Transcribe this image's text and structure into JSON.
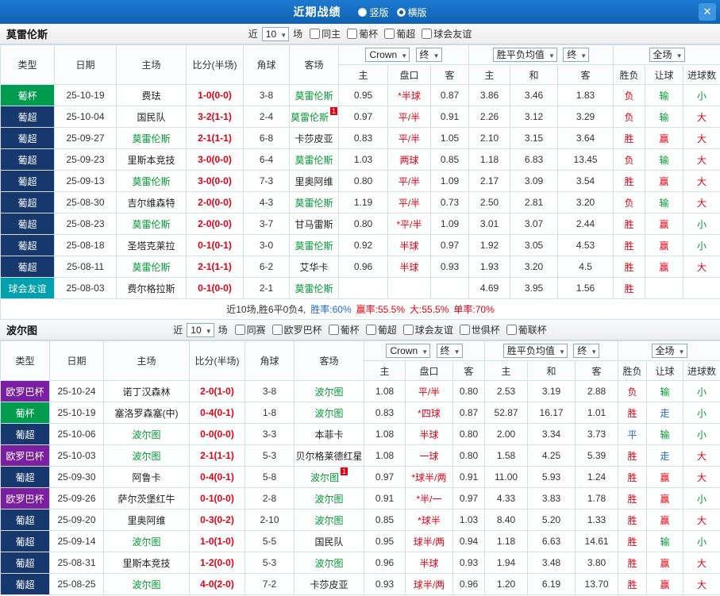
{
  "titlebar": {
    "title": "近期战绩",
    "radio_vertical": "竖版",
    "radio_horizontal": "横版",
    "close": "✕"
  },
  "filter_labels": {
    "near": "近",
    "games": "场"
  },
  "table_header": {
    "type": "类型",
    "date": "日期",
    "home": "主场",
    "score": "比分(半场)",
    "corner": "角球",
    "away": "客场",
    "odds_home": "主",
    "odds_handicap": "盘口",
    "odds_away": "客",
    "avg_home": "主",
    "avg_draw": "和",
    "avg_away": "客",
    "result": "胜负",
    "let": "让球",
    "goals": "进球数",
    "dd_bookmaker": "Crown",
    "dd_final": "终",
    "dd_avg": "胜平负均值",
    "dd_scope": "全场"
  },
  "colors": {
    "titlebar_bg": "#0f62b0",
    "accent_red": "#e60012",
    "accent_green": "#009933",
    "accent_blue": "#1e6bd6",
    "focus_team": "#009933",
    "type_badges": {
      "葡杯": "#009b4c",
      "葡超": "#16386d",
      "球会友谊": "#00a0ae",
      "欧罗巴杯": "#7a1fa2"
    },
    "result_colors": {
      "胜": "#e60012",
      "平": "#1e6bd6",
      "负": "#e60012",
      "赢": "#e60012",
      "输": "#009933",
      "走": "#1e6bd6",
      "大": "#e60012",
      "小": "#009933"
    }
  },
  "sections": [
    {
      "team": "莫雷伦斯",
      "games_count": "10",
      "filter_checkboxes": [
        "同主",
        "葡杯",
        "葡超",
        "球会友谊"
      ],
      "rows": [
        {
          "type": "葡杯",
          "date": "25-10-19",
          "home": "费珐",
          "score": "1-0(0-0)",
          "corner": "3-8",
          "away": "莫雷伦斯",
          "away_focus": true,
          "odds": [
            "0.95",
            "*半球",
            "0.87"
          ],
          "avg": [
            "3.86",
            "3.46",
            "1.83"
          ],
          "result": "负",
          "let": "输",
          "goals": "小"
        },
        {
          "type": "葡超",
          "date": "25-10-04",
          "home": "国民队",
          "score": "3-2(1-1)",
          "corner": "2-4",
          "away": "莫雷伦斯",
          "away_focus": true,
          "away_card": "1",
          "odds": [
            "0.97",
            "平/半",
            "0.91"
          ],
          "avg": [
            "2.26",
            "3.12",
            "3.29"
          ],
          "result": "负",
          "let": "输",
          "goals": "大"
        },
        {
          "type": "葡超",
          "date": "25-09-27",
          "home": "莫雷伦斯",
          "home_focus": true,
          "score": "2-1(1-1)",
          "corner": "6-8",
          "away": "卡莎皮亚",
          "odds": [
            "0.83",
            "平/半",
            "1.05"
          ],
          "avg": [
            "2.10",
            "3.15",
            "3.64"
          ],
          "result": "胜",
          "let": "赢",
          "goals": "大"
        },
        {
          "type": "葡超",
          "date": "25-09-23",
          "home": "里斯本竞技",
          "score": "3-0(0-0)",
          "corner": "6-4",
          "away": "莫雷伦斯",
          "away_focus": true,
          "odds": [
            "1.03",
            "两球",
            "0.85"
          ],
          "avg": [
            "1.18",
            "6.83",
            "13.45"
          ],
          "result": "负",
          "let": "输",
          "goals": "大"
        },
        {
          "type": "葡超",
          "date": "25-09-13",
          "home": "莫雷伦斯",
          "home_focus": true,
          "score": "3-0(0-0)",
          "corner": "7-3",
          "away": "里奥阿维",
          "odds": [
            "0.80",
            "平/半",
            "1.09"
          ],
          "avg": [
            "2.17",
            "3.09",
            "3.54"
          ],
          "result": "胜",
          "let": "赢",
          "goals": "大"
        },
        {
          "type": "葡超",
          "date": "25-08-30",
          "home": "吉尔维森特",
          "score": "2-0(0-0)",
          "corner": "4-3",
          "away": "莫雷伦斯",
          "away_focus": true,
          "odds": [
            "1.19",
            "平/半",
            "0.73"
          ],
          "avg": [
            "2.50",
            "2.81",
            "3.20"
          ],
          "result": "负",
          "let": "输",
          "goals": "大"
        },
        {
          "type": "葡超",
          "date": "25-08-23",
          "home": "莫雷伦斯",
          "home_focus": true,
          "score": "2-0(0-0)",
          "corner": "3-7",
          "away": "甘马雷斯",
          "odds": [
            "0.80",
            "*平/半",
            "1.09"
          ],
          "avg": [
            "3.01",
            "3.07",
            "2.44"
          ],
          "result": "胜",
          "let": "赢",
          "goals": "小"
        },
        {
          "type": "葡超",
          "date": "25-08-18",
          "home": "圣塔克莱拉",
          "score": "0-1(0-1)",
          "corner": "3-0",
          "away": "莫雷伦斯",
          "away_focus": true,
          "odds": [
            "0.92",
            "半球",
            "0.97"
          ],
          "avg": [
            "1.92",
            "3.05",
            "4.53"
          ],
          "result": "胜",
          "let": "赢",
          "goals": "小"
        },
        {
          "type": "葡超",
          "date": "25-08-11",
          "home": "莫雷伦斯",
          "home_focus": true,
          "score": "2-1(1-1)",
          "corner": "6-2",
          "away": "艾华卡",
          "odds": [
            "0.96",
            "半球",
            "0.93"
          ],
          "avg": [
            "1.93",
            "3.20",
            "4.5"
          ],
          "result": "胜",
          "let": "赢",
          "goals": "大"
        },
        {
          "type": "球会友谊",
          "date": "25-08-03",
          "home": "费尔格拉斯",
          "score": "0-1(0-0)",
          "corner": "2-1",
          "away": "莫雷伦斯",
          "away_focus": true,
          "odds": [
            "",
            "",
            ""
          ],
          "avg": [
            "4.69",
            "3.95",
            "1.56"
          ],
          "result": "胜",
          "let": "",
          "goals": ""
        }
      ],
      "summary": [
        {
          "text": "近10场,胜6平0负4,",
          "color": "#333333"
        },
        {
          "text": "胜率:60%",
          "color": "#1e6bd6"
        },
        {
          "text": "赢率:55.5%",
          "color": "#e60012"
        },
        {
          "text": "大:55.5%",
          "color": "#e60012"
        },
        {
          "text": "单率:70%",
          "color": "#e60012"
        }
      ]
    },
    {
      "team": "波尔图",
      "games_count": "10",
      "filter_checkboxes": [
        "同赛",
        "欧罗巴杯",
        "葡杯",
        "葡超",
        "球会友谊",
        "世俱杯",
        "葡联杯"
      ],
      "rows": [
        {
          "type": "欧罗巴杯",
          "date": "25-10-24",
          "home": "诺丁汉森林",
          "score": "2-0(1-0)",
          "corner": "3-8",
          "away": "波尔图",
          "away_focus": true,
          "odds": [
            "1.08",
            "平/半",
            "0.80"
          ],
          "avg": [
            "2.53",
            "3.19",
            "2.88"
          ],
          "result": "负",
          "let": "输",
          "goals": "小"
        },
        {
          "type": "葡杯",
          "date": "25-10-19",
          "home": "塞洛罗森塞(中)",
          "score": "0-4(0-1)",
          "corner": "1-8",
          "away": "波尔图",
          "away_focus": true,
          "odds": [
            "0.83",
            "*四球",
            "0.87"
          ],
          "avg": [
            "52.87",
            "16.17",
            "1.01"
          ],
          "result": "胜",
          "let": "走",
          "goals": "小"
        },
        {
          "type": "葡超",
          "date": "25-10-06",
          "home": "波尔图",
          "home_focus": true,
          "score": "0-0(0-0)",
          "corner": "3-3",
          "away": "本菲卡",
          "odds": [
            "1.08",
            "半球",
            "0.80"
          ],
          "avg": [
            "2.00",
            "3.34",
            "3.73"
          ],
          "result": "平",
          "let": "输",
          "goals": "小"
        },
        {
          "type": "欧罗巴杯",
          "date": "25-10-03",
          "home": "波尔图",
          "home_focus": true,
          "score": "2-1(1-1)",
          "corner": "5-3",
          "away": "贝尔格莱德红星",
          "odds": [
            "1.08",
            "一球",
            "0.80"
          ],
          "avg": [
            "1.58",
            "4.25",
            "5.39"
          ],
          "result": "胜",
          "let": "走",
          "goals": "大"
        },
        {
          "type": "葡超",
          "date": "25-09-30",
          "home": "阿鲁卡",
          "score": "0-4(0-1)",
          "corner": "5-8",
          "away": "波尔图",
          "away_focus": true,
          "away_card": "1",
          "odds": [
            "0.97",
            "*球半/两",
            "0.91"
          ],
          "avg": [
            "11.00",
            "5.93",
            "1.24"
          ],
          "result": "胜",
          "let": "赢",
          "goals": "大"
        },
        {
          "type": "欧罗巴杯",
          "date": "25-09-26",
          "home": "萨尔茨堡红牛",
          "score": "0-1(0-0)",
          "corner": "2-8",
          "away": "波尔图",
          "away_focus": true,
          "odds": [
            "0.91",
            "*半/一",
            "0.97"
          ],
          "avg": [
            "4.33",
            "3.83",
            "1.78"
          ],
          "result": "胜",
          "let": "赢",
          "goals": "小"
        },
        {
          "type": "葡超",
          "date": "25-09-20",
          "home": "里奥阿维",
          "score": "0-3(0-2)",
          "corner": "2-10",
          "away": "波尔图",
          "away_focus": true,
          "odds": [
            "0.85",
            "*球半",
            "1.03"
          ],
          "avg": [
            "8.40",
            "5.20",
            "1.33"
          ],
          "result": "胜",
          "let": "赢",
          "goals": "大"
        },
        {
          "type": "葡超",
          "date": "25-09-14",
          "home": "波尔图",
          "home_focus": true,
          "score": "1-0(1-0)",
          "corner": "5-5",
          "away": "国民队",
          "odds": [
            "0.95",
            "球半/两",
            "0.94"
          ],
          "avg": [
            "1.18",
            "6.63",
            "14.61"
          ],
          "result": "胜",
          "let": "输",
          "goals": "小"
        },
        {
          "type": "葡超",
          "date": "25-08-31",
          "home": "里斯本竞技",
          "score": "1-2(0-0)",
          "corner": "5-3",
          "away": "波尔图",
          "away_focus": true,
          "odds": [
            "0.96",
            "半球",
            "0.93"
          ],
          "avg": [
            "1.94",
            "3.48",
            "3.80"
          ],
          "result": "胜",
          "let": "赢",
          "goals": "大"
        },
        {
          "type": "葡超",
          "date": "25-08-25",
          "home": "波尔图",
          "home_focus": true,
          "score": "4-0(2-0)",
          "corner": "7-2",
          "away": "卡莎皮亚",
          "odds": [
            "0.93",
            "球半/两",
            "0.96"
          ],
          "avg": [
            "1.20",
            "6.19",
            "13.70"
          ],
          "result": "胜",
          "let": "赢",
          "goals": "大"
        }
      ]
    }
  ]
}
